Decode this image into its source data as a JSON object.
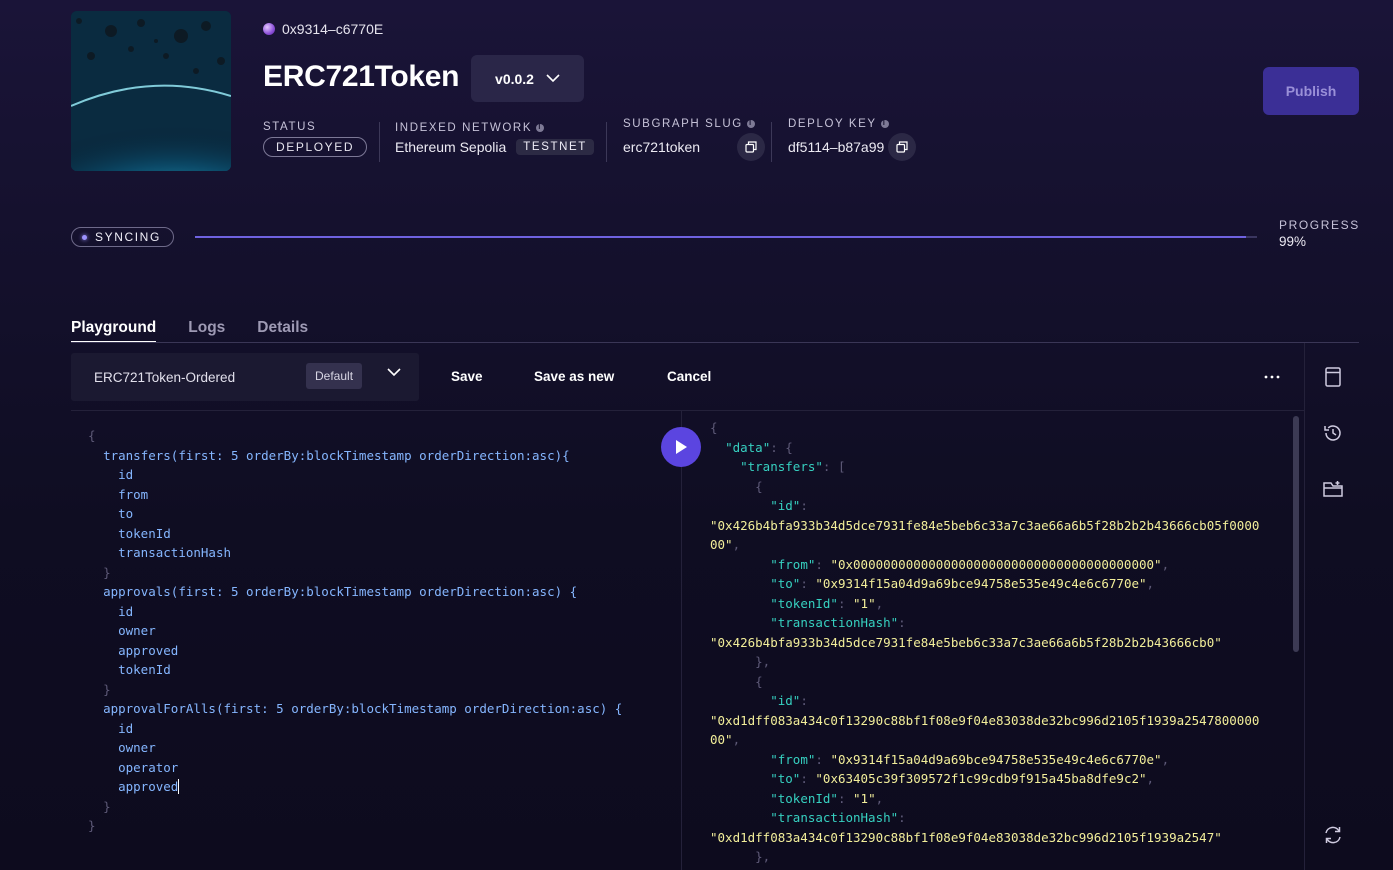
{
  "header": {
    "address": "0x9314–c6770E",
    "title": "ERC721Token",
    "version": "v0.0.2",
    "publish_label": "Publish"
  },
  "meta": {
    "status_label": "STATUS",
    "status_value": "DEPLOYED",
    "network_label": "INDEXED NETWORK",
    "network_value": "Ethereum Sepolia",
    "network_badge": "TESTNET",
    "slug_label": "SUBGRAPH SLUG",
    "slug_value": "erc721token",
    "deploy_key_label": "DEPLOY KEY",
    "deploy_key_value": "df5114–b87a99"
  },
  "sync": {
    "status": "SYNCING",
    "progress_label": "PROGRESS",
    "progress_value": "99%",
    "progress_fraction": 0.99
  },
  "tabs": [
    {
      "label": "Playground"
    },
    {
      "label": "Logs"
    },
    {
      "label": "Details"
    }
  ],
  "toolbar": {
    "query_name": "ERC721Token-Ordered",
    "default_badge": "Default",
    "save_label": "Save",
    "save_new_label": "Save as new",
    "cancel_label": "Cancel"
  },
  "query": {
    "transfers_block": "transfers(first: 5 orderBy:blockTimestamp orderDirection:asc){",
    "transfers_fields": [
      "id",
      "from",
      "to",
      "tokenId",
      "transactionHash"
    ],
    "approvals_block": "approvals(first: 5 orderBy:blockTimestamp orderDirection:asc) {",
    "approvals_fields": [
      "id",
      "owner",
      "approved",
      "tokenId"
    ],
    "approvalforalls_block": "approvalForAlls(first: 5 orderBy:blockTimestamp orderDirection:asc) {",
    "approvalforalls_fields": [
      "id",
      "owner",
      "operator",
      "approved"
    ]
  },
  "result": {
    "record1": {
      "id_line1": "\"0x426b4bfa933b34d5dce7931fe84e5beb6c33a7c3ae66a6b5f28b2b2b43666cb05f0000",
      "id_line2": "00\"",
      "from": "\"0x0000000000000000000000000000000000000000\"",
      "to": "\"0x9314f15a04d9a69bce94758e535e49c4e6c6770e\"",
      "tokenId": "\"1\"",
      "transactionHash": "\"0x426b4bfa933b34d5dce7931fe84e5beb6c33a7c3ae66a6b5f28b2b2b43666cb0\""
    },
    "record2": {
      "id_line1": "\"0xd1dff083a434c0f13290c88bf1f08e9f04e83038de32bc996d2105f1939a2547800000",
      "id_line2": "00\"",
      "from": "\"0x9314f15a04d9a69bce94758e535e49c4e6c6770e\"",
      "to": "\"0x63405c39f309572f1c99cdb9f915a45ba8dfe9c2\"",
      "tokenId": "\"1\"",
      "transactionHash": "\"0xd1dff083a434c0f13290c88bf1f08e9f04e83038de32bc996d2105f1939a2547\""
    }
  },
  "icons": {
    "side1": "bookmark-icon",
    "side2": "history-icon",
    "side3": "folder-add-icon",
    "side4": "refresh-icon"
  }
}
